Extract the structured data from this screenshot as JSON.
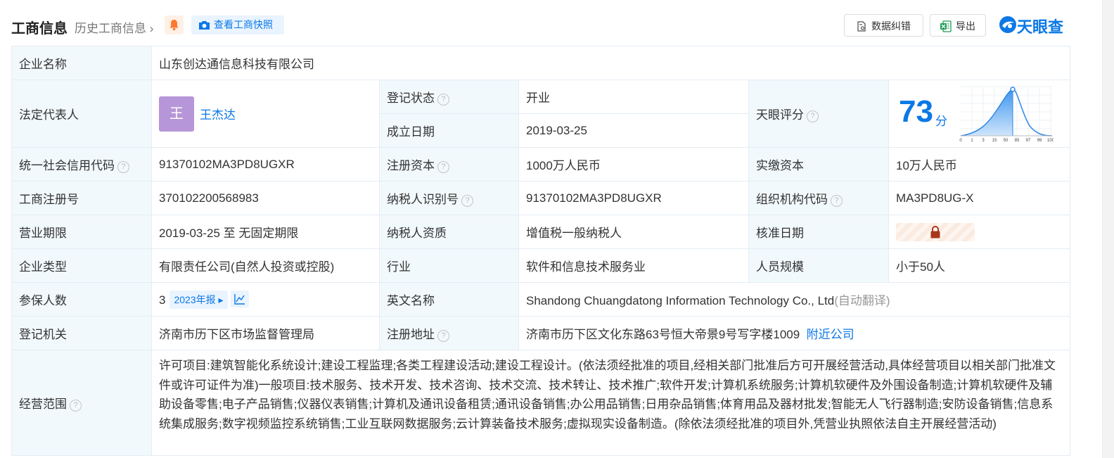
{
  "header": {
    "title": "工商信息",
    "history_link": "历史工商信息",
    "snapshot_button": "查看工商快照",
    "data_fix_button": "数据纠错",
    "export_button": "导出",
    "logo_text": "天眼查",
    "brand_color": "#0b78e6"
  },
  "company": {
    "name_label": "企业名称",
    "name": "山东创达通信息科技有限公司",
    "legal_rep_label": "法定代表人",
    "legal_rep_avatar": "王",
    "legal_rep_name": "王杰达",
    "status_label": "登记状态",
    "status": "开业",
    "established_label": "成立日期",
    "established": "2019-03-25",
    "score_label": "天眼评分",
    "score": "73",
    "score_unit": "分",
    "score_ticks": [
      "0",
      "1",
      "3",
      "15",
      "50",
      "85",
      "97",
      "99",
      "100"
    ],
    "credit_code_label": "统一社会信用代码",
    "credit_code": "91370102MA3PD8UGXR",
    "reg_capital_label": "注册资本",
    "reg_capital": "1000万人民币",
    "paid_capital_label": "实缴资本",
    "paid_capital": "10万人民币",
    "reg_no_label": "工商注册号",
    "reg_no": "370102200568983",
    "taxpayer_id_label": "纳税人识别号",
    "taxpayer_id": "91370102MA3PD8UGXR",
    "org_code_label": "组织机构代码",
    "org_code": "MA3PD8UG-X",
    "term_label": "营业期限",
    "term": "2019-03-25 至 无固定期限",
    "taxpayer_qual_label": "纳税人资质",
    "taxpayer_qual": "增值税一般纳税人",
    "approval_date_label": "核准日期",
    "type_label": "企业类型",
    "type": "有限责任公司(自然人投资或控股)",
    "industry_label": "行业",
    "industry": "软件和信息技术服务业",
    "staff_size_label": "人员规模",
    "staff_size": "小于50人",
    "insured_label": "参保人数",
    "insured": "3",
    "insured_report": "2023年报",
    "english_name_label": "英文名称",
    "english_name": "Shandong Chuangdatong Information Technology Co., Ltd",
    "english_name_note": "(自动翻译)",
    "authority_label": "登记机关",
    "authority": "济南市历下区市场监督管理局",
    "address_label": "注册地址",
    "address": "济南市历下区文化东路63号恒大帝景9号写字楼1009",
    "nearby_link": "附近公司",
    "scope_label": "经营范围",
    "scope": "许可项目:建筑智能化系统设计;建设工程监理;各类工程建设活动;建设工程设计。(依法须经批准的项目,经相关部门批准后方可开展经营活动,具体经营项目以相关部门批准文件或许可证件为准)一般项目:技术服务、技术开发、技术咨询、技术交流、技术转让、技术推广;软件开发;计算机系统服务;计算机软硬件及外围设备制造;计算机软硬件及辅助设备零售;电子产品销售;仪器仪表销售;计算机及通讯设备租赁;通讯设备销售;办公用品销售;日用杂品销售;体育用品及器材批发;智能无人飞行器制造;安防设备销售;信息系统集成服务;数字视频监控系统销售;工业互联网数据服务;云计算装备技术服务;虚拟现实设备制造。(除依法须经批准的项目外,凭营业执照依法自主开展经营活动)"
  }
}
